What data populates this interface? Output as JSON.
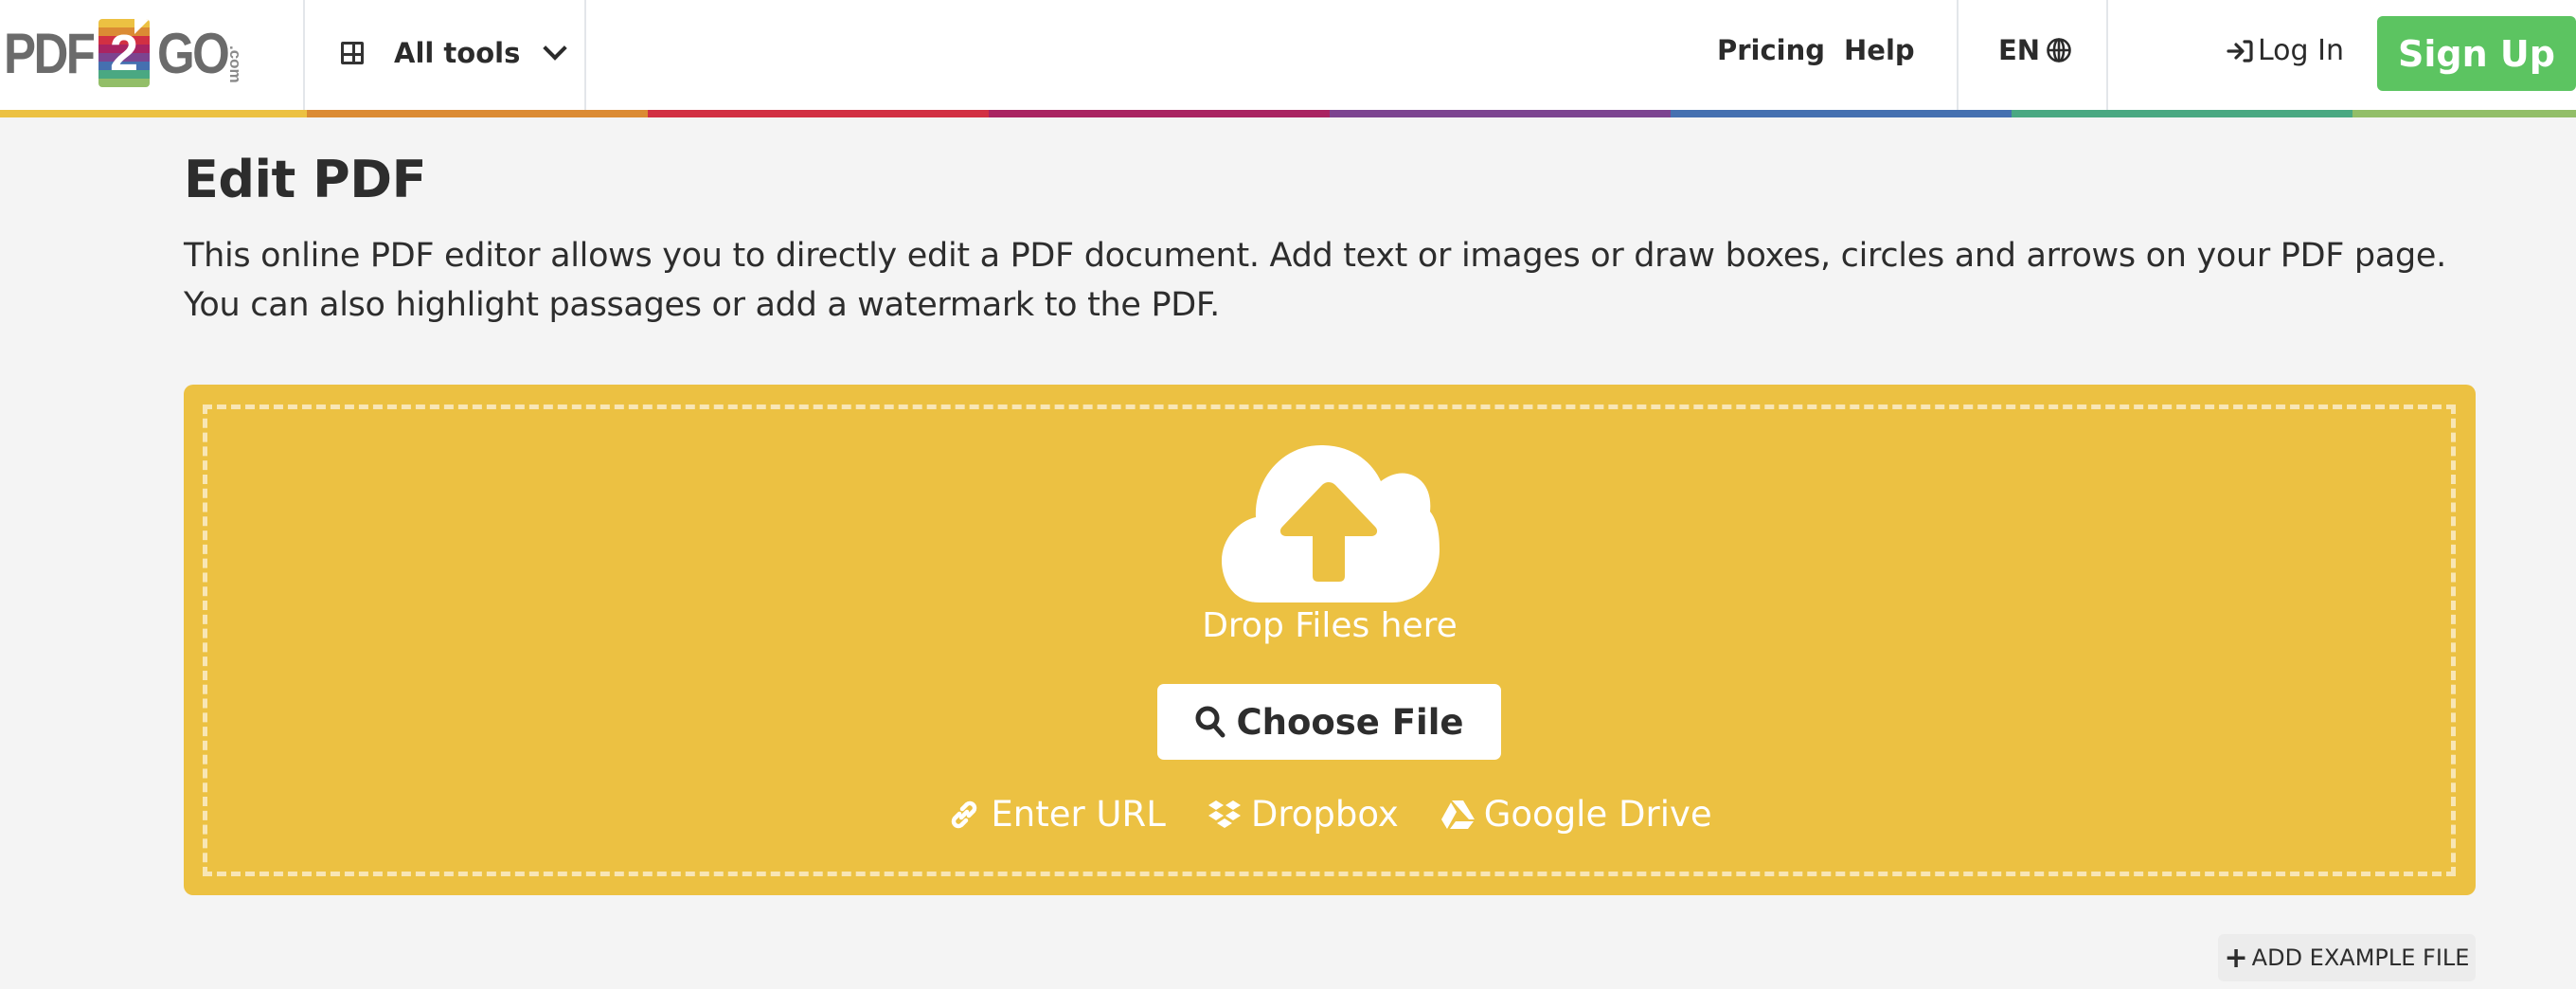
{
  "header": {
    "logo": {
      "left": "PDF",
      "middle": "2",
      "right": "GO",
      "suffix": ".com"
    },
    "all_tools_label": "All tools",
    "nav": {
      "pricing": "Pricing",
      "help": "Help"
    },
    "language": "EN",
    "login_label": "Log In",
    "signup_label": "Sign Up",
    "colors": {
      "signup": "#5cc461",
      "bar": [
        "#ecc142",
        "#db8b34",
        "#d23043",
        "#a92462",
        "#7c4490",
        "#4570b0",
        "#4aa882",
        "#92be68"
      ]
    }
  },
  "main": {
    "title": "Edit PDF",
    "description": "This online PDF editor allows you to directly edit a PDF document. Add text or images or draw boxes, circles and arrows on your PDF page. You can also highlight passages or add a watermark to the PDF."
  },
  "upload": {
    "drop_text": "Drop Files here",
    "choose_file_label": "Choose File",
    "sources": [
      {
        "label": "Enter URL",
        "icon": "link-icon"
      },
      {
        "label": "Dropbox",
        "icon": "dropbox-icon"
      },
      {
        "label": "Google Drive",
        "icon": "google-drive-icon"
      }
    ],
    "accent_color": "#ecc142"
  },
  "add_example_label": "ADD EXAMPLE FILE"
}
